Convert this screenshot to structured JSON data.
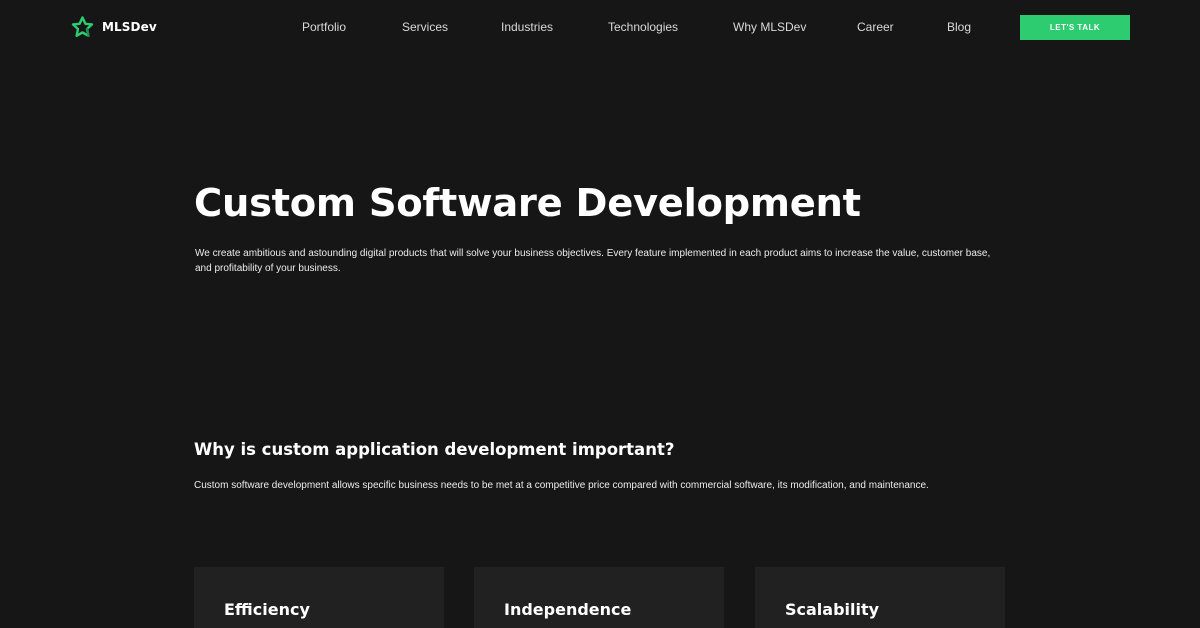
{
  "header": {
    "logo_text": "MLSDev",
    "nav": [
      {
        "label": "Portfolio"
      },
      {
        "label": "Services"
      },
      {
        "label": "Industries"
      },
      {
        "label": "Technologies"
      },
      {
        "label": "Why MLSDev"
      },
      {
        "label": "Career"
      },
      {
        "label": "Blog"
      }
    ],
    "cta_label": "LET'S TALK"
  },
  "hero": {
    "title": "Custom Software Development",
    "description": "We create ambitious and astounding digital products that will solve your business objectives. Every feature implemented in each product aims to increase the value, customer base, and profitability of your business."
  },
  "section": {
    "title": "Why is custom application development important?",
    "description": "Custom software development allows specific business needs to be met at a competitive price compared with commercial software, its modification, and maintenance."
  },
  "cards": [
    {
      "title": "Efficiency"
    },
    {
      "title": "Independence"
    },
    {
      "title": "Scalability"
    }
  ],
  "colors": {
    "background": "#161616",
    "card_background": "#212121",
    "accent": "#2ecc71",
    "logo_green": "#2ecc71"
  },
  "icons": {
    "logo": "star-outline-logo-icon"
  }
}
